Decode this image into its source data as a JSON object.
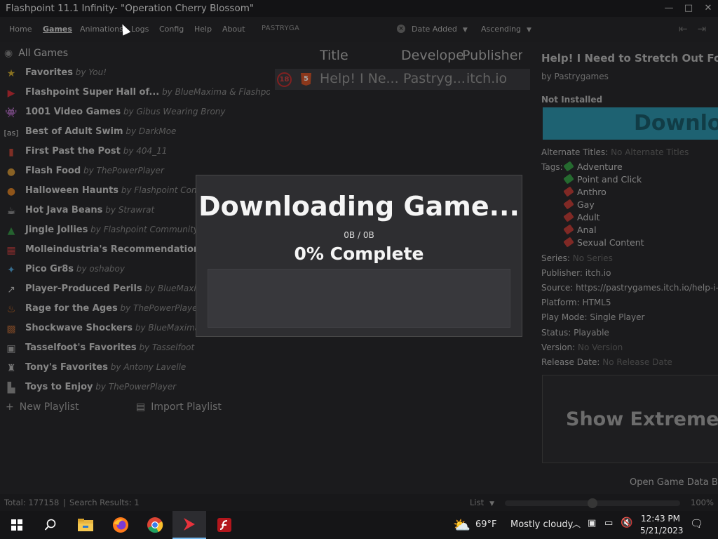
{
  "window": {
    "title": "Flashpoint 11.1 Infinity- \"Operation Cherry Blossom\"",
    "minimize": "—",
    "maximize": "□",
    "close": "✕"
  },
  "menu": {
    "items": [
      "Home",
      "Games",
      "Animations",
      "Logs",
      "Config",
      "Help",
      "About"
    ],
    "active": "Games"
  },
  "search": {
    "value": "PASTRYGA",
    "clear_glyph": "×"
  },
  "sort": {
    "by": "Date Added",
    "direction": "Ascending"
  },
  "sidebar": {
    "all_games": "All Games",
    "playlists": [
      {
        "title": "Favorites",
        "author": "You!",
        "icon": "star-icon"
      },
      {
        "title": "Flashpoint Super Hall of...",
        "author": "BlueMaxima & Flashpoin...",
        "icon": "flashpoint-logo-icon"
      },
      {
        "title": "1001 Video Games",
        "author": "Gibus Wearing Brony",
        "icon": "space-invader-icon"
      },
      {
        "title": "Best of Adult Swim",
        "author": "DarkMoe",
        "icon": "adult-swim-icon"
      },
      {
        "title": "First Past the Post",
        "author": "404_11",
        "icon": "ribbon-icon"
      },
      {
        "title": "Flash Food",
        "author": "ThePowerPlayer",
        "icon": "burger-icon"
      },
      {
        "title": "Halloween Haunts",
        "author": "Flashpoint Comm...",
        "icon": "pumpkin-icon"
      },
      {
        "title": "Hot Java Beans",
        "author": "Strawrat",
        "icon": "coffee-icon"
      },
      {
        "title": "Jingle Jollies",
        "author": "Flashpoint Community",
        "icon": "tree-icon"
      },
      {
        "title": "Molleindustria's Recommendations",
        "author": "",
        "icon": "mosaic-icon"
      },
      {
        "title": "Pico Gr8s",
        "author": "oshaboy",
        "icon": "pixel-icon"
      },
      {
        "title": "Player-Produced Perils",
        "author": "BlueMaxima",
        "icon": "share-icon"
      },
      {
        "title": "Rage for the Ages",
        "author": "ThePowerPlayer",
        "icon": "flame-icon"
      },
      {
        "title": "Shockwave Shockers",
        "author": "BlueMaxima",
        "icon": "shockwave-icon"
      },
      {
        "title": "Tasselfoot's Favorites",
        "author": "Tasselfoot",
        "icon": "cube-icon"
      },
      {
        "title": "Tony's Favorites",
        "author": "Antony Lavelle",
        "icon": "figure-icon"
      },
      {
        "title": "Toys to Enjoy",
        "author": "ThePowerPlayer",
        "icon": "toy-icon"
      }
    ],
    "by_word": "by",
    "new_playlist": "New Playlist",
    "import_playlist": "Import Playlist"
  },
  "game_list": {
    "headers": [
      "Title",
      "Develope",
      "Publisher"
    ],
    "row": {
      "badge": "18",
      "title": "Help! I Ne...",
      "developer": "Pastryg...",
      "publisher": "itch.io"
    }
  },
  "details": {
    "title": "Help! I Need to Stretch Out For Va",
    "author": "by Pastrygames",
    "install_status": "Not Installed",
    "download_label": "Downlo",
    "alternate_titles_label": "Alternate Titles:",
    "alternate_titles_value": "No Alternate Titles",
    "tags_label": "Tags:",
    "tags": [
      {
        "name": "Adventure",
        "color": "#3aa64a"
      },
      {
        "name": "Point and Click",
        "color": "#3aa64a"
      },
      {
        "name": "Anthro",
        "color": "#c9403a"
      },
      {
        "name": "Gay",
        "color": "#c9403a"
      },
      {
        "name": "Adult",
        "color": "#c9403a"
      },
      {
        "name": "Anal",
        "color": "#c9403a"
      },
      {
        "name": "Sexual Content",
        "color": "#c9403a"
      }
    ],
    "series_label": "Series:",
    "series_value": "No Series",
    "publisher_line": "Publisher: itch.io",
    "source_line": "Source: https://pastrygames.itch.io/help-i-ne",
    "platform_line": "Platform: HTML5",
    "play_mode_line": "Play Mode: Single Player",
    "status_line": "Status: Playable",
    "version_label": "Version:",
    "version_value": "No Version",
    "release_label": "Release Date:",
    "release_value": "No Release Date",
    "extreme_label": "Show Extreme Sc",
    "open_data": "Open Game Data Br"
  },
  "status_bar": {
    "total": "Total: 177158",
    "divider": "|",
    "results": "Search Results: 1",
    "view": "List",
    "zoom": "100%"
  },
  "modal": {
    "title": "Downloading Game...",
    "bytes": "0B / 0B",
    "percent_text": "0% Complete",
    "progress": 0,
    "progress_color": "#4b8bd4"
  },
  "taskbar": {
    "weather_temp": "69°F",
    "weather_desc": "Mostly cloudy",
    "time": "12:43 PM",
    "date": "5/21/2023"
  }
}
